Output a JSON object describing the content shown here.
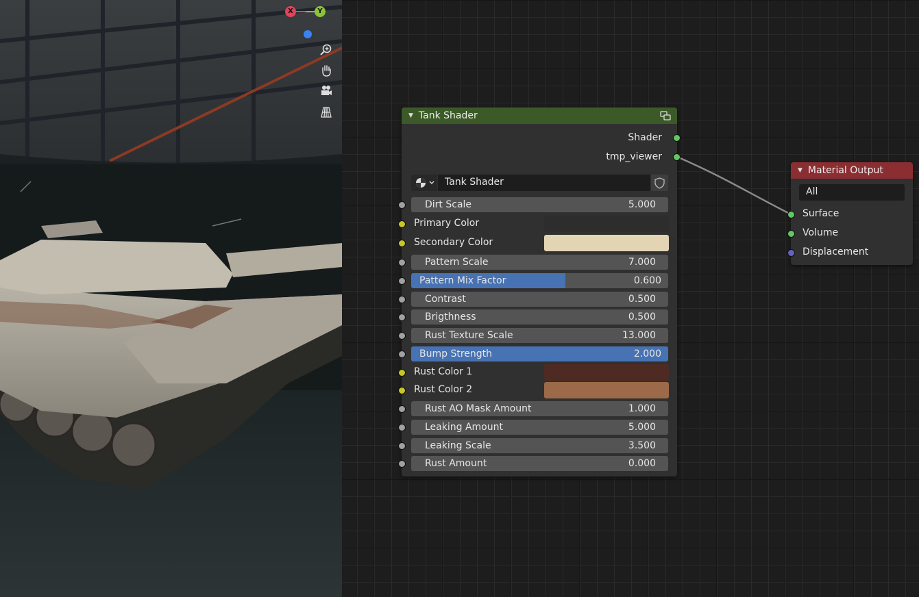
{
  "colors": {
    "group_header": "#3b5a27",
    "output_header": "#8b2e32",
    "accent": "#4772b3"
  },
  "viewport": {
    "gizmo": {
      "x_label": "X",
      "y_label": "Y"
    },
    "nav_icons": [
      "zoom-icon",
      "hand-pan-icon",
      "camera-icon",
      "grid-icon"
    ]
  },
  "tank_shader": {
    "title": "Tank Shader",
    "outputs": [
      "Shader",
      "tmp_viewer"
    ],
    "group_name": "Tank Shader",
    "inputs": [
      {
        "kind": "value",
        "label": "Dirt Scale",
        "value": "5.000"
      },
      {
        "kind": "color",
        "label": "Primary Color",
        "color": "#2d2d2d"
      },
      {
        "kind": "color",
        "label": "Secondary Color",
        "color": "#e3d5b4"
      },
      {
        "kind": "value",
        "label": "Pattern Scale",
        "value": "7.000"
      },
      {
        "kind": "factor",
        "label": "Pattern Mix Factor",
        "value": "0.600",
        "fraction": 0.6
      },
      {
        "kind": "value",
        "label": "Contrast",
        "value": "0.500"
      },
      {
        "kind": "value",
        "label": "Brigthness",
        "value": "0.500"
      },
      {
        "kind": "value",
        "label": "Rust Texture Scale",
        "value": "13.000"
      },
      {
        "kind": "factor",
        "label": "Bump Strength",
        "value": "2.000",
        "fraction": 1.0
      },
      {
        "kind": "color",
        "label": "Rust Color 1",
        "color": "#4f2a22"
      },
      {
        "kind": "color",
        "label": "Rust Color 2",
        "color": "#9c6a48"
      },
      {
        "kind": "value",
        "label": "Rust AO Mask Amount",
        "value": "1.000"
      },
      {
        "kind": "value",
        "label": "Leaking Amount",
        "value": "5.000"
      },
      {
        "kind": "value",
        "label": "Leaking Scale",
        "value": "3.500"
      },
      {
        "kind": "value",
        "label": "Rust Amount",
        "value": "0.000"
      }
    ]
  },
  "material_output": {
    "title": "Material Output",
    "target": "All",
    "inputs": [
      "Surface",
      "Volume",
      "Displacement"
    ]
  }
}
